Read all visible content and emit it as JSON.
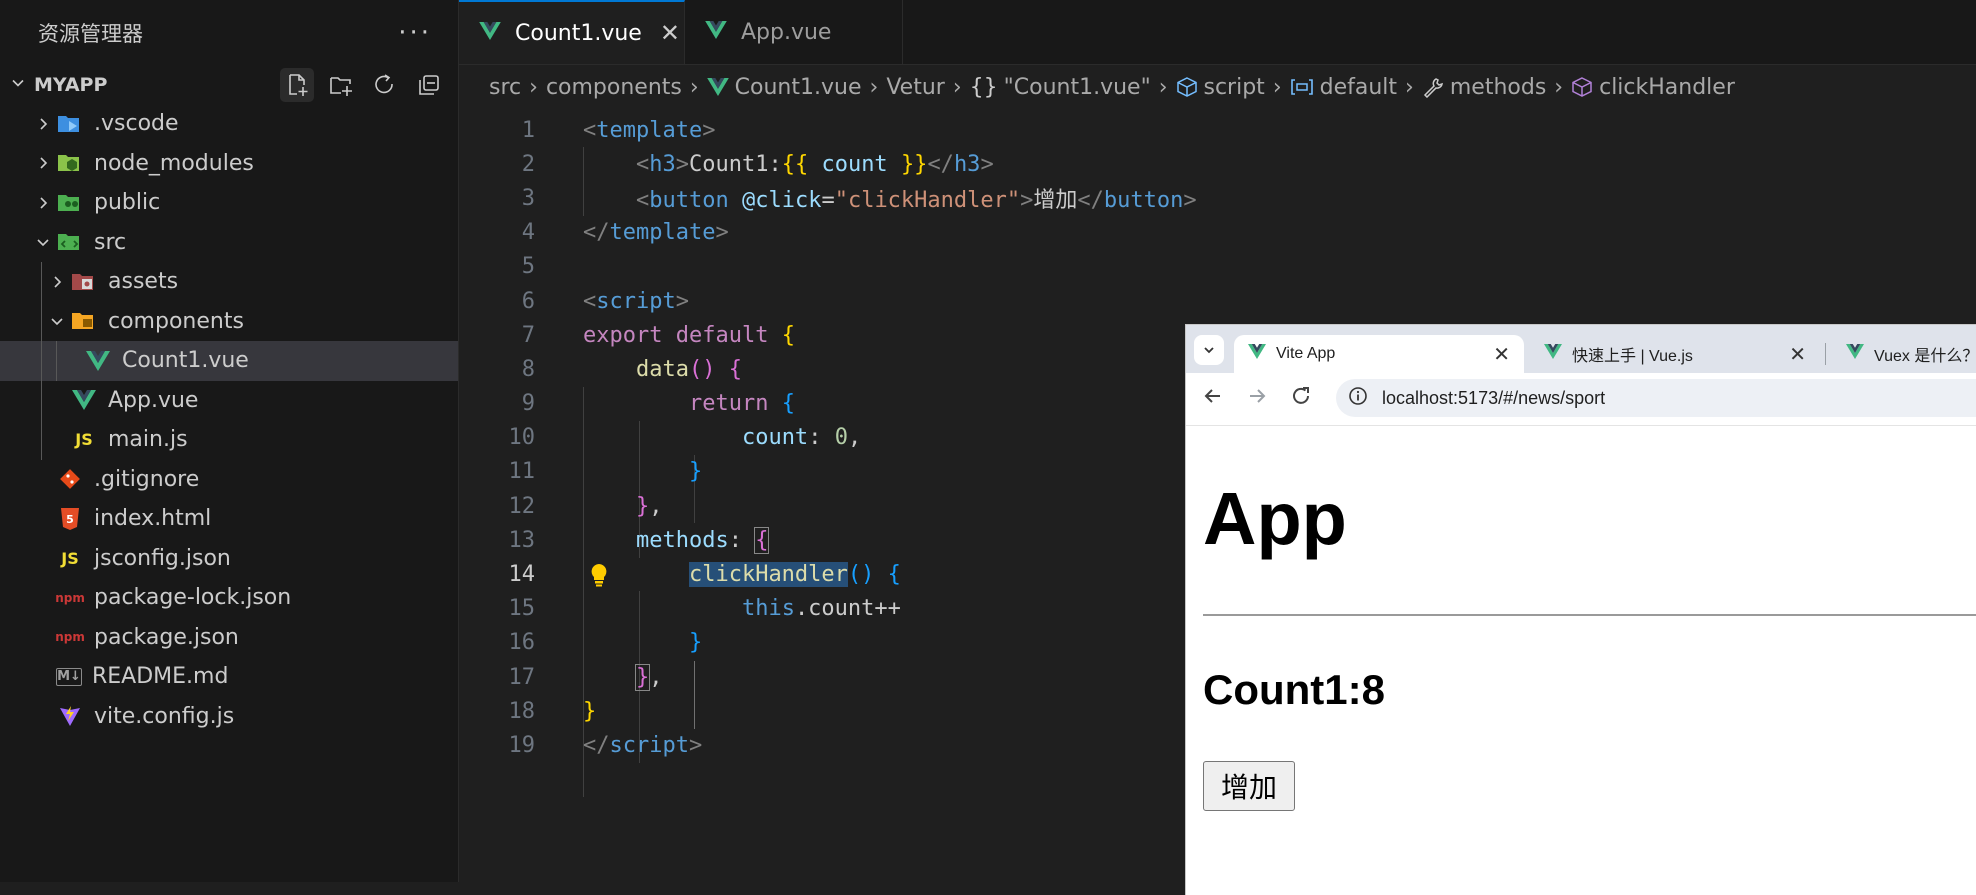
{
  "explorer": {
    "title": "资源管理器",
    "more_label": "···",
    "project": "MYAPP",
    "items": [
      {
        "label": ".vscode",
        "type": "folder",
        "icon": "vscode-folder-icon",
        "color": "#3d8fe0"
      },
      {
        "label": "node_modules",
        "type": "folder",
        "icon": "node-folder-icon",
        "color": "#8bc34a"
      },
      {
        "label": "public",
        "type": "folder",
        "icon": "public-folder-icon",
        "color": "#4caf50"
      },
      {
        "label": "src",
        "type": "folder",
        "icon": "src-folder-icon",
        "color": "#4caf50"
      },
      {
        "label": "assets",
        "type": "folder",
        "icon": "assets-folder-icon",
        "color": "#e05c5c"
      },
      {
        "label": "components",
        "type": "folder",
        "icon": "components-folder-icon",
        "color": "#f5a623"
      },
      {
        "label": "Count1.vue",
        "type": "file",
        "icon": "vue-icon",
        "color": "#41b883"
      },
      {
        "label": "App.vue",
        "type": "file",
        "icon": "vue-icon",
        "color": "#41b883"
      },
      {
        "label": "main.js",
        "type": "file",
        "icon": "js-icon",
        "color": "#f1dd35"
      },
      {
        "label": ".gitignore",
        "type": "file",
        "icon": "git-icon",
        "color": "#e64a19"
      },
      {
        "label": "index.html",
        "type": "file",
        "icon": "html5-icon",
        "color": "#e44d26"
      },
      {
        "label": "jsconfig.json",
        "type": "file",
        "icon": "js-icon",
        "color": "#f1dd35"
      },
      {
        "label": "package-lock.json",
        "type": "file",
        "icon": "npm-icon",
        "color": "#cb3837"
      },
      {
        "label": "package.json",
        "type": "file",
        "icon": "npm-icon",
        "color": "#cb3837"
      },
      {
        "label": "README.md",
        "type": "file",
        "icon": "markdown-icon",
        "color": "#a0a0a0"
      },
      {
        "label": "vite.config.js",
        "type": "file",
        "icon": "vite-icon",
        "color": "#9f6bff"
      }
    ],
    "file_icon_text": {
      "js": "JS",
      "npm": "npm",
      "md": "M↓"
    }
  },
  "editor": {
    "tabs": [
      {
        "label": "Count1.vue",
        "active": true
      },
      {
        "label": "App.vue",
        "active": false
      }
    ],
    "breadcrumbs": [
      "src",
      "components",
      "Count1.vue",
      "Vetur",
      "\"Count1.vue\"",
      "script",
      "default",
      "methods",
      "clickHandler"
    ],
    "current_line": 14,
    "lines": [
      {
        "n": "1"
      },
      {
        "n": "2"
      },
      {
        "n": "3"
      },
      {
        "n": "4"
      },
      {
        "n": "5"
      },
      {
        "n": "6"
      },
      {
        "n": "7"
      },
      {
        "n": "8"
      },
      {
        "n": "9"
      },
      {
        "n": "10"
      },
      {
        "n": "11"
      },
      {
        "n": "12"
      },
      {
        "n": "13"
      },
      {
        "n": "14"
      },
      {
        "n": "15"
      },
      {
        "n": "16"
      },
      {
        "n": "17"
      },
      {
        "n": "18"
      },
      {
        "n": "19"
      }
    ],
    "code": {
      "template": "template",
      "h3": "h3",
      "count1_text": "Count1:",
      "mustache_open": "{{",
      "count_var": "count",
      "mustache_close": "}}",
      "button": "button",
      "click_attr": "@click",
      "eq": "=",
      "click_value": "\"clickHandler\"",
      "button_text": "增加",
      "script": "script",
      "export": "export",
      "default": "default",
      "data": "data",
      "return": "return",
      "count_key": "count",
      "zero": "0",
      "methods": "methods",
      "handler": "clickHandler",
      "this": "this",
      "count_incr": ".count++"
    }
  },
  "browser": {
    "tabs": [
      {
        "label": "Vite App",
        "active": true
      },
      {
        "label": "快速上手 | Vue.js",
        "active": false
      },
      {
        "label": "Vuex 是什么？ |",
        "active": false
      }
    ],
    "url": "localhost:5173/#/news/sport",
    "page": {
      "heading": "App",
      "counter_text": "Count1:8",
      "button_label": "增加"
    }
  }
}
